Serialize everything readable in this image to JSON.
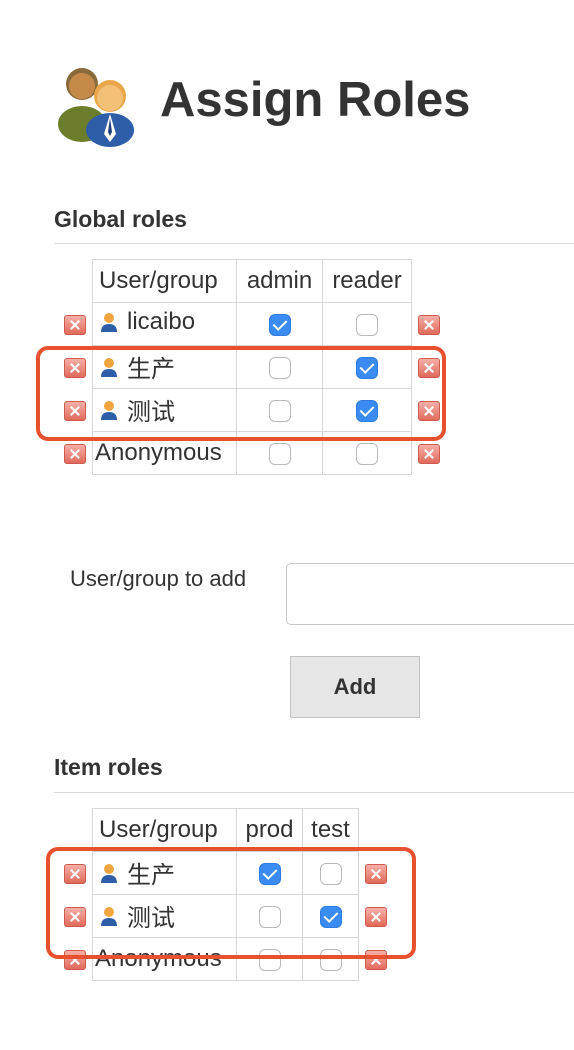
{
  "page": {
    "title": "Assign Roles",
    "header_icon": "users-icon"
  },
  "global_roles": {
    "heading": "Global roles",
    "column_header": "User/group",
    "roles": [
      "admin",
      "reader"
    ],
    "rows": [
      {
        "name": "licaibo",
        "icon": "user-icon",
        "checks": [
          true,
          false
        ]
      },
      {
        "name": "生产",
        "icon": "user-icon",
        "checks": [
          false,
          true
        ]
      },
      {
        "name": "测试",
        "icon": "user-icon",
        "checks": [
          false,
          true
        ]
      },
      {
        "name": "Anonymous",
        "icon": "",
        "checks": [
          false,
          false
        ]
      }
    ]
  },
  "add_form": {
    "label": "User/group to add",
    "value": "",
    "button_label": "Add"
  },
  "item_roles": {
    "heading": "Item roles",
    "column_header": "User/group",
    "roles": [
      "prod",
      "test"
    ],
    "rows": [
      {
        "name": "生产",
        "icon": "user-icon",
        "checks": [
          true,
          false
        ]
      },
      {
        "name": "测试",
        "icon": "user-icon",
        "checks": [
          false,
          true
        ]
      },
      {
        "name": "Anonymous",
        "icon": "",
        "checks": [
          false,
          false
        ]
      }
    ]
  },
  "colors": {
    "checkbox_checked": "#3a8cf2",
    "annotation": "#e8512f",
    "delete_icon": "#e06a5c"
  }
}
